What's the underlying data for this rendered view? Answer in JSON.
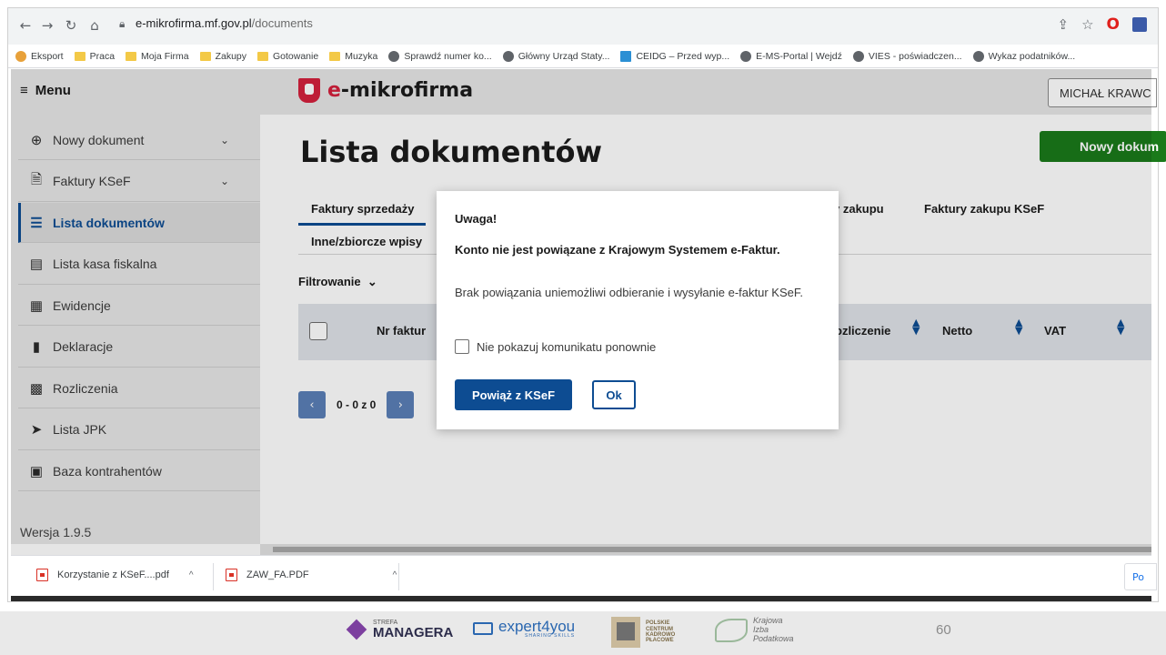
{
  "browser": {
    "url_host": "e-mikrofirma.mf.gov.pl",
    "url_path": "/documents",
    "bookmarks": [
      {
        "label": "Eksport",
        "icon": "site-icon",
        "color": "#e8a13a"
      },
      {
        "label": "Praca",
        "icon": "folder-icon"
      },
      {
        "label": "Moja Firma",
        "icon": "folder-icon"
      },
      {
        "label": "Zakupy",
        "icon": "folder-icon"
      },
      {
        "label": "Gotowanie",
        "icon": "folder-icon"
      },
      {
        "label": "Muzyka",
        "icon": "folder-icon"
      },
      {
        "label": "Sprawdź numer ko...",
        "icon": "globe-icon"
      },
      {
        "label": "Główny Urząd Staty...",
        "icon": "site-icon"
      },
      {
        "label": "CEIDG – Przed wyp...",
        "icon": "ceidg-icon"
      },
      {
        "label": "E-MS-Portal | Wejdź",
        "icon": "site-icon"
      },
      {
        "label": "VIES - poświadczen...",
        "icon": "globe-icon"
      },
      {
        "label": "Wykaz podatników...",
        "icon": "site-icon"
      }
    ]
  },
  "header": {
    "menu_label": "Menu",
    "app_name_prefix": "e",
    "app_name_rest": "-mikrofirma",
    "user_label": "MICHAŁ KRAWC"
  },
  "sidebar": {
    "items": [
      {
        "label": "Nowy dokument",
        "icon": "plus-circle-icon",
        "has_chevron": true,
        "active": false
      },
      {
        "label": "Faktury KSeF",
        "icon": "invoice-icon",
        "has_chevron": true,
        "active": false
      },
      {
        "label": "Lista dokumentów",
        "icon": "list-icon",
        "has_chevron": false,
        "active": true
      },
      {
        "label": "Lista kasa fiskalna",
        "icon": "cash-register-icon",
        "has_chevron": false,
        "active": false
      },
      {
        "label": "Ewidencje",
        "icon": "ledger-icon",
        "has_chevron": false,
        "active": false
      },
      {
        "label": "Deklaracje",
        "icon": "document-icon",
        "has_chevron": false,
        "active": false
      },
      {
        "label": "Rozliczenia",
        "icon": "calculator-icon",
        "has_chevron": false,
        "active": false
      },
      {
        "label": "Lista JPK",
        "icon": "send-icon",
        "has_chevron": false,
        "active": false
      },
      {
        "label": "Baza kontrahentów",
        "icon": "contacts-icon",
        "has_chevron": false,
        "active": false
      }
    ],
    "version": "Wersja 1.9.5"
  },
  "main": {
    "title": "Lista dokumentów",
    "new_doc_label": "Nowy dokum",
    "tabs": [
      {
        "label": "Faktury sprzedaży",
        "active": true
      },
      {
        "label": "y zakupu",
        "active": false
      },
      {
        "label": "Faktury zakupu KSeF",
        "active": false
      },
      {
        "label": "Inne/zbiorcze wpisy",
        "active": false
      }
    ],
    "filter_label": "Filtrowanie",
    "columns": [
      {
        "label": "Nr faktur"
      },
      {
        "label": "ozliczenie"
      },
      {
        "label": "Netto"
      },
      {
        "label": "VAT"
      }
    ],
    "pager_text": "0 - 0 z 0"
  },
  "dialog": {
    "title": "Uwaga!",
    "heading": "Konto nie jest powiązane z Krajowym Systemem e-Faktur.",
    "body": "Brak powiązania uniemożliwi odbieranie i wysyłanie e-faktur KSeF.",
    "checkbox_label": "Nie pokazuj komunikatu ponownie",
    "primary_button": "Powiąż z KSeF",
    "secondary_button": "Ok"
  },
  "downloads": {
    "items": [
      {
        "label": "Korzystanie z KSeF....pdf"
      },
      {
        "label": "ZAW_FA.PDF"
      }
    ],
    "show_all_label": "Po"
  },
  "footer": {
    "sponsor1_small": "STREFA",
    "sponsor1_big": "MANAGERA",
    "sponsor2_big": "expert4you",
    "sponsor2_small": "SHARING SKILLS",
    "sponsor3_lines": [
      "POLSKIE",
      "CENTRUM",
      "KADROWO",
      "PŁACOWE"
    ],
    "sponsor4_lines": [
      "Krajowa",
      "Izba",
      "Podatkowa"
    ],
    "slide_number": "60"
  },
  "colors": {
    "accent": "#0d4c92",
    "new_doc_green": "#1a7a1a",
    "logo_red": "#d4213d"
  }
}
